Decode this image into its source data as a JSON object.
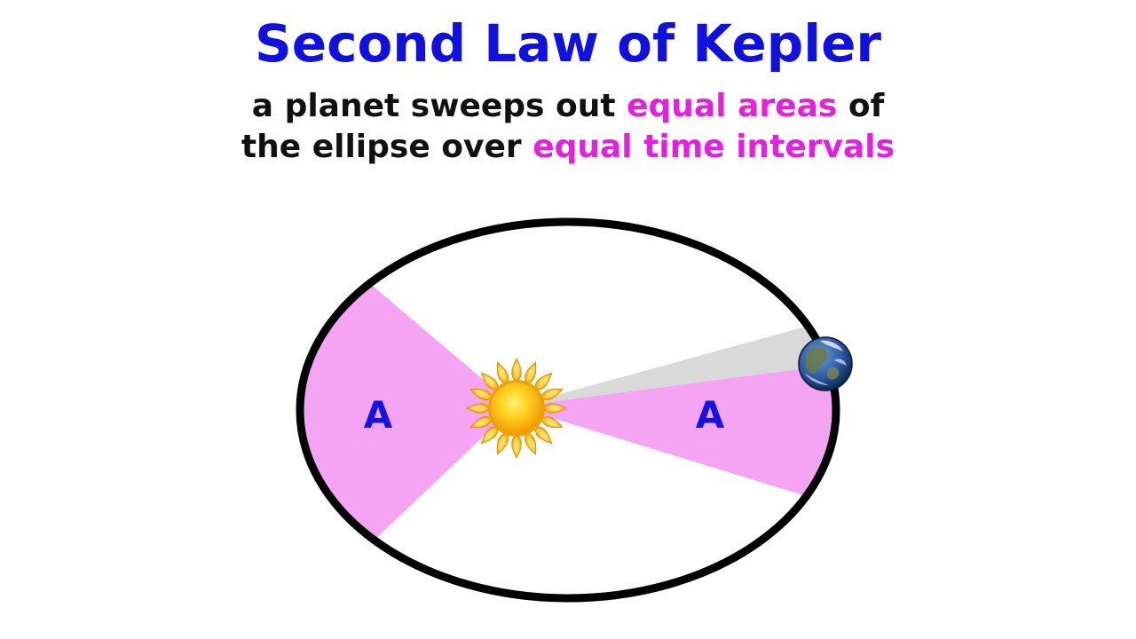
{
  "title": "Second Law of Kepler",
  "subtitle": {
    "line1_prefix": "a planet sweeps out ",
    "line1_highlight": "equal areas",
    "line1_suffix": " of",
    "line2_prefix": "the ellipse over ",
    "line2_highlight": "equal time intervals"
  },
  "diagram": {
    "left_area_label": "A",
    "right_area_label": "A",
    "sun_icon": "sun-icon",
    "planet_icon": "earth-icon"
  },
  "colors": {
    "title": "#1010e0",
    "highlight": "#e51ee0",
    "swept_area": "#f5a3f3",
    "current_sweep": "#d9d9d9",
    "orbit": "#000000"
  }
}
